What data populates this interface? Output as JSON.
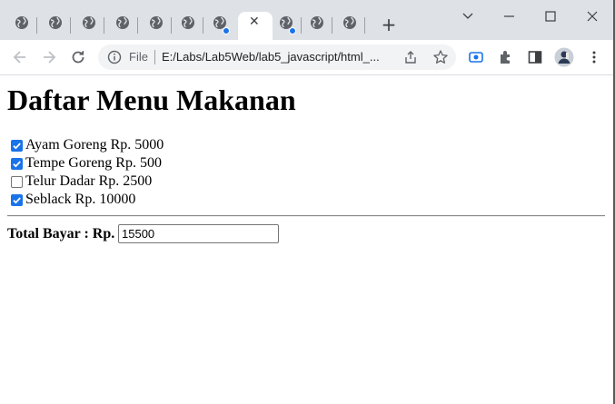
{
  "browser": {
    "tabs_count_left": 7,
    "tabs_count_right": 2,
    "active_tab_close": "✕",
    "new_tab_label": "+",
    "omnibox": {
      "scheme_label": "File",
      "url": "E:/Labs/Lab5Web/lab5_javascript/html_..."
    },
    "window_controls": {
      "dropdown": "⌄",
      "minimize": "—",
      "maximize": "☐",
      "close": "✕"
    }
  },
  "page": {
    "title": "Daftar Menu Makanan",
    "menu": [
      {
        "label": "Ayam Goreng Rp. 5000",
        "checked": true
      },
      {
        "label": "Tempe Goreng Rp. 500",
        "checked": true
      },
      {
        "label": "Telur Dadar Rp. 2500",
        "checked": false
      },
      {
        "label": "Seblack Rp. 10000",
        "checked": true
      }
    ],
    "total_label": "Total Bayar : Rp.",
    "total_value": "15500"
  },
  "colors": {
    "accent": "#1a73e8",
    "tabstrip": "#dee1e6",
    "omnibox": "#f1f3f4"
  }
}
